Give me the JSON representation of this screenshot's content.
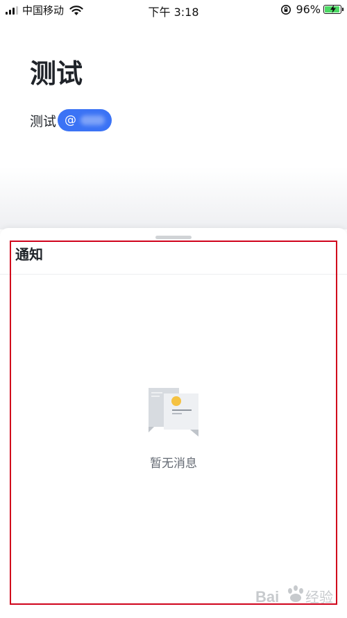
{
  "status_bar": {
    "carrier": "中国移动",
    "time": "下午 3:18",
    "battery_percent": "96%",
    "battery_level": 0.96,
    "icons": [
      "signal-icon",
      "wifi-icon",
      "rotation-lock-icon",
      "battery-icon",
      "charging-bolt-icon"
    ]
  },
  "document": {
    "title": "测试",
    "line_text": "测试",
    "mention_symbol": "@"
  },
  "notifications_sheet": {
    "title": "通知",
    "empty_message": "暂无消息",
    "empty_icon": "empty-messages-illustration"
  },
  "watermark": {
    "text": "Baidu 经验"
  },
  "colors": {
    "mention_chip": "#3b73f5",
    "annotation_frame": "#d0021b",
    "battery_fill": "#4cd964",
    "empty_text": "#646a73"
  }
}
